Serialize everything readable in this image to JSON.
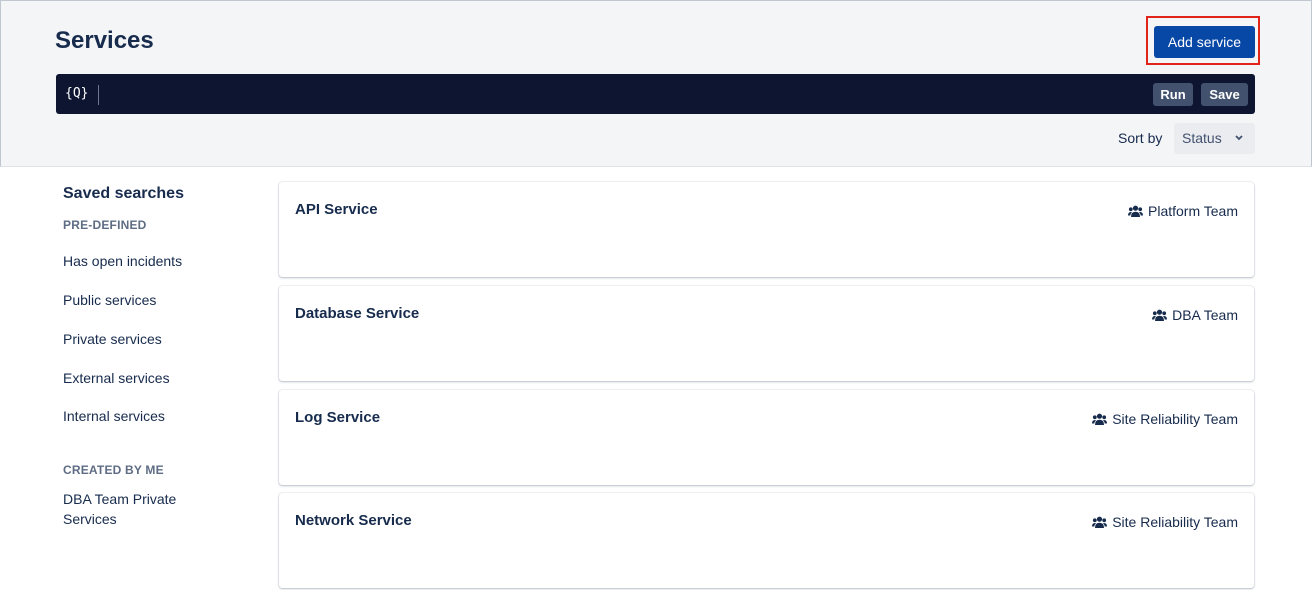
{
  "header": {
    "title": "Services",
    "add_button": "Add service",
    "query_icon": "{Q}",
    "run_button": "Run",
    "save_button": "Save",
    "sort_label": "Sort by",
    "sort_value": "Status"
  },
  "sidebar": {
    "title": "Saved searches",
    "predefined_label": "PRE-DEFINED",
    "predefined_items": [
      "Has open incidents",
      "Public services",
      "Private services",
      "External services",
      "Internal services"
    ],
    "created_label": "CREATED BY ME",
    "created_items": [
      "DBA Team Private Services"
    ]
  },
  "services": [
    {
      "name": "API Service",
      "team": "Platform Team"
    },
    {
      "name": "Database Service",
      "team": "DBA Team"
    },
    {
      "name": "Log Service",
      "team": "Site Reliability Team"
    },
    {
      "name": "Network Service",
      "team": "Site Reliability Team"
    }
  ],
  "icons": {
    "query": "query-icon",
    "sort": "chevron-down-icon",
    "team": "team-icon"
  },
  "colors": {
    "primary_button": "#0747A6",
    "query_bar": "#0D1530",
    "highlight": "#E2231A"
  }
}
